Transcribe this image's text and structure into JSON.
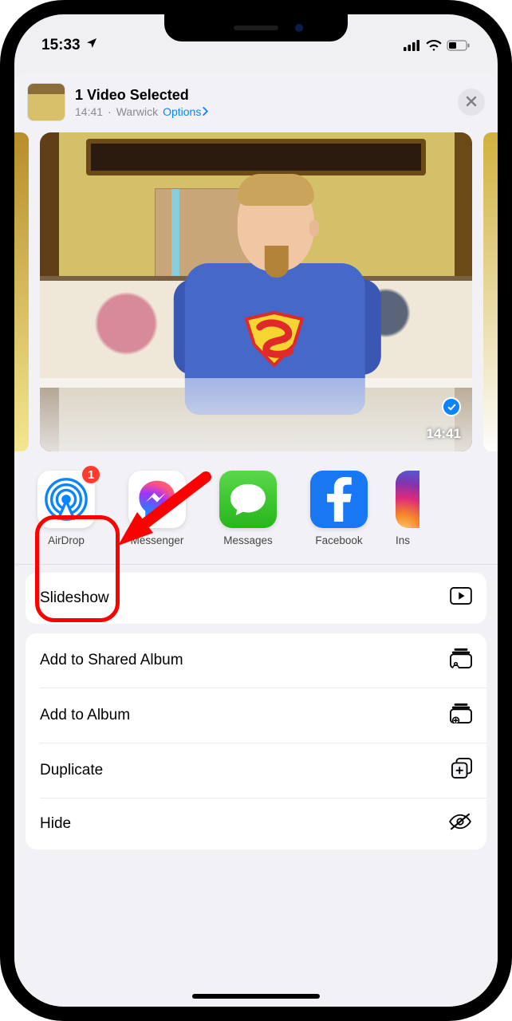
{
  "status": {
    "time": "15:33"
  },
  "header": {
    "title": "1 Video Selected",
    "timestamp": "14:41",
    "location": "Warwick",
    "options_label": "Options"
  },
  "preview": {
    "selected": true,
    "duration": "14:41"
  },
  "apps": [
    {
      "name": "AirDrop",
      "badge": "1"
    },
    {
      "name": "Messenger"
    },
    {
      "name": "Messages"
    },
    {
      "name": "Facebook"
    },
    {
      "name_partial": "Ins"
    }
  ],
  "actions": {
    "slideshow": "Slideshow",
    "add_shared": "Add to Shared Album",
    "add_album": "Add to Album",
    "duplicate": "Duplicate",
    "hide": "Hide"
  }
}
